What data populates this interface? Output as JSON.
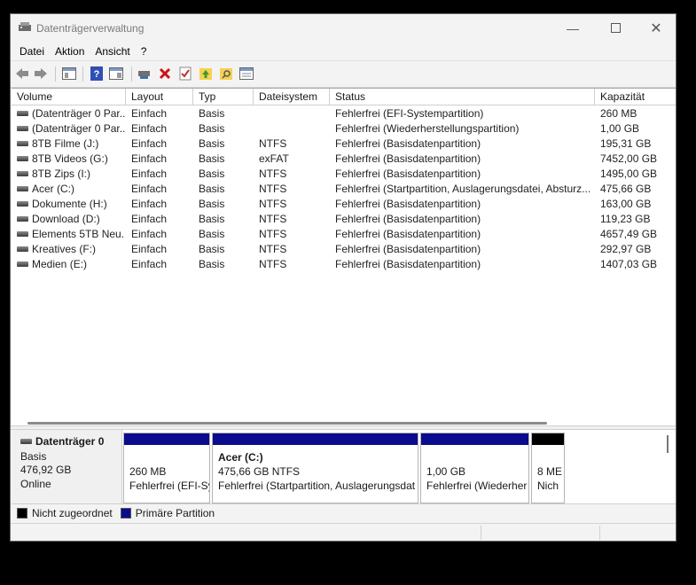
{
  "window": {
    "title": "Datenträgerverwaltung"
  },
  "menu": [
    "Datei",
    "Aktion",
    "Ansicht",
    "?"
  ],
  "toolbar": [
    "back-icon",
    "forward-icon",
    "properties-icon",
    "help-icon",
    "console-icon",
    "connect-icon",
    "delete-icon",
    "check-icon",
    "up-icon",
    "find-icon",
    "rescan-icon"
  ],
  "columns": [
    "Volume",
    "Layout",
    "Typ",
    "Dateisystem",
    "Status",
    "Kapazität"
  ],
  "rows": [
    {
      "volume": "(Datenträger 0 Par...",
      "layout": "Einfach",
      "typ": "Basis",
      "fs": "",
      "status": "Fehlerfrei (EFI-Systempartition)",
      "capacity": "260 MB"
    },
    {
      "volume": "(Datenträger 0 Par...",
      "layout": "Einfach",
      "typ": "Basis",
      "fs": "",
      "status": "Fehlerfrei (Wiederherstellungspartition)",
      "capacity": "1,00 GB"
    },
    {
      "volume": "8TB Filme (J:)",
      "layout": "Einfach",
      "typ": "Basis",
      "fs": "NTFS",
      "status": "Fehlerfrei (Basisdatenpartition)",
      "capacity": "195,31 GB"
    },
    {
      "volume": "8TB Videos (G:)",
      "layout": "Einfach",
      "typ": "Basis",
      "fs": "exFAT",
      "status": "Fehlerfrei (Basisdatenpartition)",
      "capacity": "7452,00 GB"
    },
    {
      "volume": "8TB Zips (I:)",
      "layout": "Einfach",
      "typ": "Basis",
      "fs": "NTFS",
      "status": "Fehlerfrei (Basisdatenpartition)",
      "capacity": "1495,00 GB"
    },
    {
      "volume": "Acer (C:)",
      "layout": "Einfach",
      "typ": "Basis",
      "fs": "NTFS",
      "status": "Fehlerfrei (Startpartition, Auslagerungsdatei, Absturz...",
      "capacity": "475,66 GB"
    },
    {
      "volume": "Dokumente (H:)",
      "layout": "Einfach",
      "typ": "Basis",
      "fs": "NTFS",
      "status": "Fehlerfrei (Basisdatenpartition)",
      "capacity": "163,00 GB"
    },
    {
      "volume": "Download (D:)",
      "layout": "Einfach",
      "typ": "Basis",
      "fs": "NTFS",
      "status": "Fehlerfrei (Basisdatenpartition)",
      "capacity": "119,23 GB"
    },
    {
      "volume": "Elements 5TB Neu...",
      "layout": "Einfach",
      "typ": "Basis",
      "fs": "NTFS",
      "status": "Fehlerfrei (Basisdatenpartition)",
      "capacity": "4657,49 GB"
    },
    {
      "volume": "Kreatives (F:)",
      "layout": "Einfach",
      "typ": "Basis",
      "fs": "NTFS",
      "status": "Fehlerfrei (Basisdatenpartition)",
      "capacity": "292,97 GB"
    },
    {
      "volume": "Medien (E:)",
      "layout": "Einfach",
      "typ": "Basis",
      "fs": "NTFS",
      "status": "Fehlerfrei (Basisdatenpartition)",
      "capacity": "1407,03 GB"
    }
  ],
  "disk": {
    "name": "Datenträger 0",
    "type": "Basis",
    "size": "476,92 GB",
    "state": "Online"
  },
  "partitions": [
    {
      "title": "",
      "line1": "260 MB",
      "line2": "Fehlerfrei (EFI-Sy",
      "color": "#0b0b8e"
    },
    {
      "title": "Acer  (C:)",
      "line1": "475,66 GB NTFS",
      "line2": "Fehlerfrei (Startpartition, Auslagerungsdat",
      "color": "#0b0b8e"
    },
    {
      "title": "",
      "line1": "1,00 GB",
      "line2": "Fehlerfrei (Wiederher",
      "color": "#0b0b8e"
    },
    {
      "title": "",
      "line1": "8 ME",
      "line2": "Nich",
      "color": "#000000"
    }
  ],
  "legend": [
    {
      "label": "Nicht zugeordnet",
      "color": "#000000"
    },
    {
      "label": "Primäre Partition",
      "color": "#0b0b8e"
    }
  ]
}
